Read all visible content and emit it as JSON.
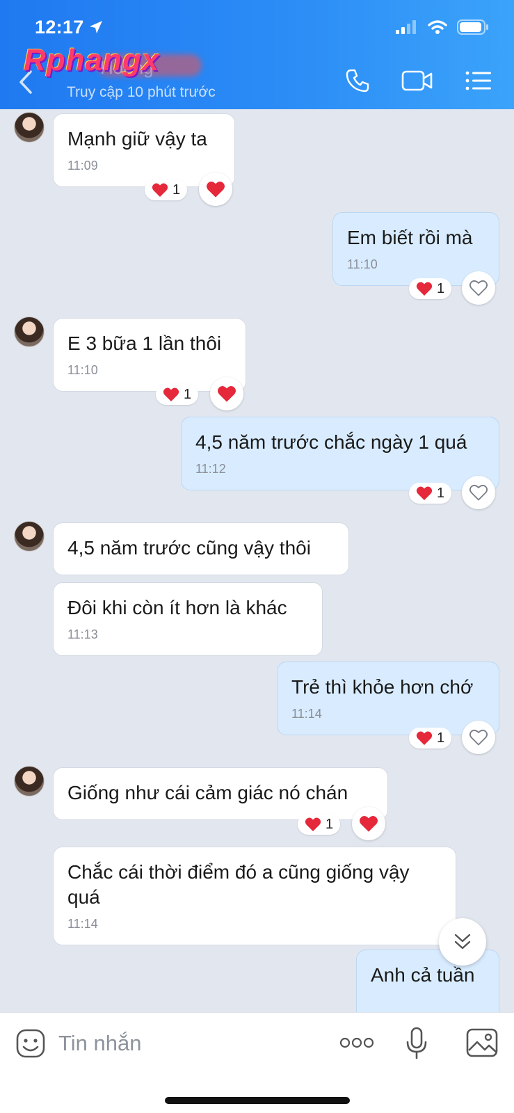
{
  "status_bar": {
    "time": "12:17"
  },
  "header": {
    "brand": "Rphangx",
    "contact_name": "Hoàng",
    "last_seen": "Truy cập 10 phút trước",
    "icons": {
      "back": "chevron-left-icon",
      "call": "phone-icon",
      "video": "video-camera-icon",
      "menu": "list-menu-icon"
    }
  },
  "messages": [
    {
      "dir": "in",
      "text": "Mạnh giữ vậy ta",
      "time": "11:09",
      "reaction_count": "1"
    },
    {
      "dir": "out",
      "text": "Em biết rồi mà",
      "time": "11:10",
      "reaction_count": "1"
    },
    {
      "dir": "in",
      "text": "E 3 bữa 1 lần thôi",
      "time": "11:10",
      "reaction_count": "1"
    },
    {
      "dir": "out",
      "text": "4,5 năm trước chắc ngày 1 quá",
      "time": "11:12",
      "reaction_count": "1"
    },
    {
      "dir": "in",
      "text": "4,5 năm trước cũng vậy thôi",
      "time": ""
    },
    {
      "dir": "in",
      "text": "Đôi khi còn ít hơn là khác",
      "time": "11:13"
    },
    {
      "dir": "out",
      "text": "Trẻ thì khỏe hơn chớ",
      "time": "11:14",
      "reaction_count": "1"
    },
    {
      "dir": "in",
      "text": "Giống như cái cảm giác nó chán",
      "time": "",
      "reaction_count": "1"
    },
    {
      "dir": "in",
      "text": "Chắc cái thời điểm đó a cũng giống vậy quá",
      "time": "11:14"
    },
    {
      "dir": "out",
      "text": "Anh cả tuần",
      "time": ""
    }
  ],
  "composer": {
    "placeholder": "Tin nhắn"
  },
  "colors": {
    "header_start": "#1f79f0",
    "header_end": "#3ba3fa",
    "incoming_bubble": "#ffffff",
    "outgoing_bubble": "#d9ecff",
    "chat_background": "#e2e6ef",
    "heart": "#e5283a"
  }
}
